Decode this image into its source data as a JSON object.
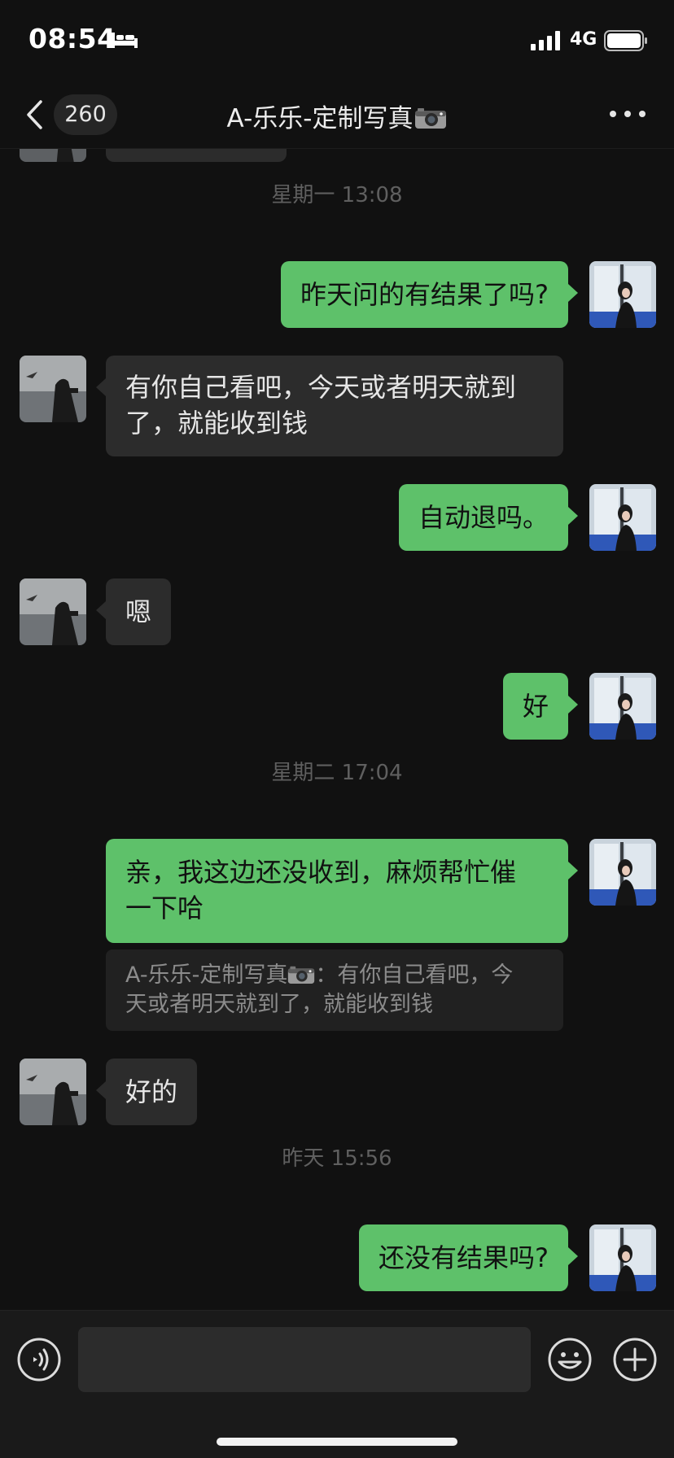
{
  "status_bar": {
    "time": "08:54",
    "network": "4G",
    "icons": [
      "bed-icon",
      "signal-icon",
      "battery-icon"
    ]
  },
  "nav": {
    "back_icon": "chevron-left-icon",
    "unread_count": "260",
    "title": "A-乐乐-定制写真",
    "title_icon": "camera-icon",
    "more_icon": "more-dots-icon"
  },
  "messages": [
    {
      "type": "timestamp",
      "text": "星期一 13:08"
    },
    {
      "type": "out",
      "text": "昨天问的有结果了吗?"
    },
    {
      "type": "in",
      "lines": [
        "有你自己看吧，今天或者明天就到",
        "了，就能收到钱"
      ]
    },
    {
      "type": "out",
      "text": "自动退吗。"
    },
    {
      "type": "in",
      "text": "嗯"
    },
    {
      "type": "out",
      "text": "好"
    },
    {
      "type": "timestamp",
      "text": "星期二 17:04"
    },
    {
      "type": "out",
      "lines": [
        "亲，我这边还没收到，麻烦帮忙催",
        "一下哈"
      ]
    },
    {
      "type": "quote",
      "sender": "A-乐乐-定制写真",
      "separator": "：",
      "line1_text": "有你自己看吧，今",
      "line2_text": "天或者明天就到了，就能收到钱"
    },
    {
      "type": "in",
      "text": "好的"
    },
    {
      "type": "timestamp",
      "text": "昨天 15:56"
    },
    {
      "type": "out",
      "text": "还没有结果吗?"
    }
  ],
  "input_bar": {
    "icons": [
      "voice-icon",
      "emoji-icon",
      "plus-icon"
    ],
    "input_value": ""
  },
  "colors": {
    "background": "#111111",
    "outgoing_bubble": "#5ec16a",
    "incoming_bubble": "#2c2c2c",
    "timestamp_text": "#5f5f5f"
  }
}
